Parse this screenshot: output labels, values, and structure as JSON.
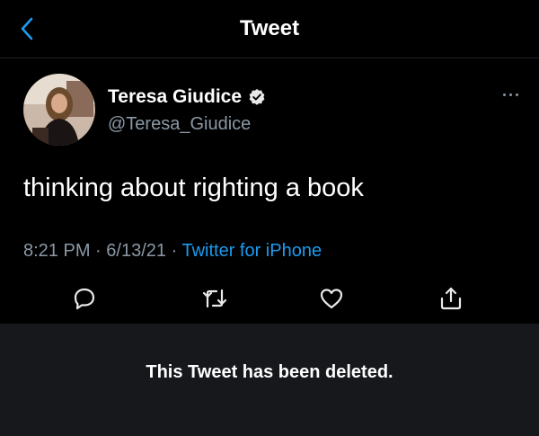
{
  "header": {
    "back_icon": "chevron-left-icon",
    "title": "Tweet"
  },
  "author": {
    "name": "Teresa Giudice",
    "handle": "@Teresa_Giudice",
    "verified_icon": "verified-badge-icon"
  },
  "tweet": {
    "text": "thinking about righting a book",
    "time": "8:21 PM",
    "date": "6/13/21",
    "separator": "·",
    "source": "Twitter for iPhone"
  },
  "actions": [
    {
      "icon": "reply-icon"
    },
    {
      "icon": "retweet-icon"
    },
    {
      "icon": "like-icon"
    },
    {
      "icon": "share-icon"
    }
  ],
  "deleted_notice": "This Tweet has been deleted.",
  "colors": {
    "background": "#000000",
    "panel": "#16181c",
    "accent": "#1d9bf0",
    "muted": "#8b98a5"
  }
}
